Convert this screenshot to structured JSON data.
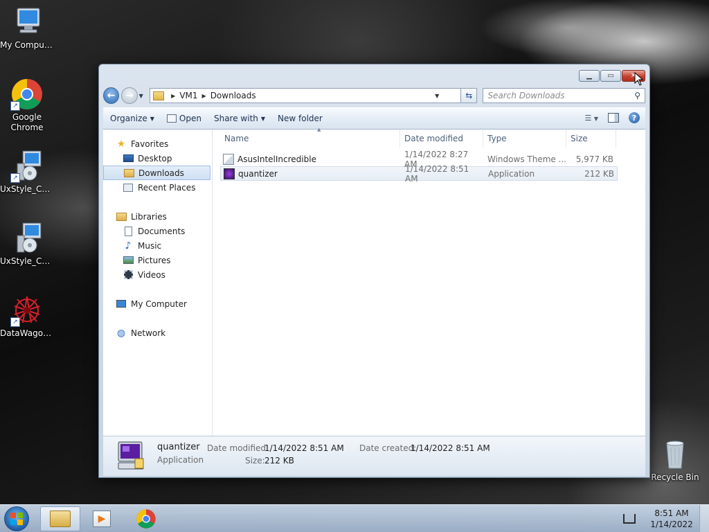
{
  "desktop": {
    "icons": [
      {
        "label": "My Computer"
      },
      {
        "label": "Google Chrome"
      },
      {
        "label": "UxStyle_Cor..."
      },
      {
        "label": "UxStyle_Cor..."
      },
      {
        "label": "DataWagon..."
      },
      {
        "label": "Recycle Bin"
      }
    ]
  },
  "window": {
    "address": {
      "crumbs": [
        "VM1",
        "Downloads"
      ]
    },
    "search": {
      "placeholder": "Search Downloads"
    },
    "toolbar": {
      "organize": "Organize",
      "open": "Open",
      "share_with": "Share with",
      "new_folder": "New folder"
    },
    "nav": {
      "favorites": "Favorites",
      "desktop": "Desktop",
      "downloads": "Downloads",
      "recent_places": "Recent Places",
      "libraries": "Libraries",
      "documents": "Documents",
      "music": "Music",
      "pictures": "Pictures",
      "videos": "Videos",
      "my_computer": "My Computer",
      "network": "Network"
    },
    "columns": {
      "name": "Name",
      "date_modified": "Date modified",
      "type": "Type",
      "size": "Size"
    },
    "files": [
      {
        "name": "AsusIntelIncredible",
        "date": "1/14/2022 8:27 AM",
        "type": "Windows Theme ...",
        "size": "5,977 KB"
      },
      {
        "name": "quantizer",
        "date": "1/14/2022 8:51 AM",
        "type": "Application",
        "size": "212 KB"
      }
    ],
    "details": {
      "name": "quantizer",
      "type": "Application",
      "date_modified_label": "Date modified:",
      "date_modified": "1/14/2022 8:51 AM",
      "date_created_label": "Date created:",
      "date_created": "1/14/2022 8:51 AM",
      "size_label": "Size:",
      "size": "212 KB"
    }
  },
  "taskbar": {
    "time": "8:51 AM",
    "date": "1/14/2022"
  }
}
